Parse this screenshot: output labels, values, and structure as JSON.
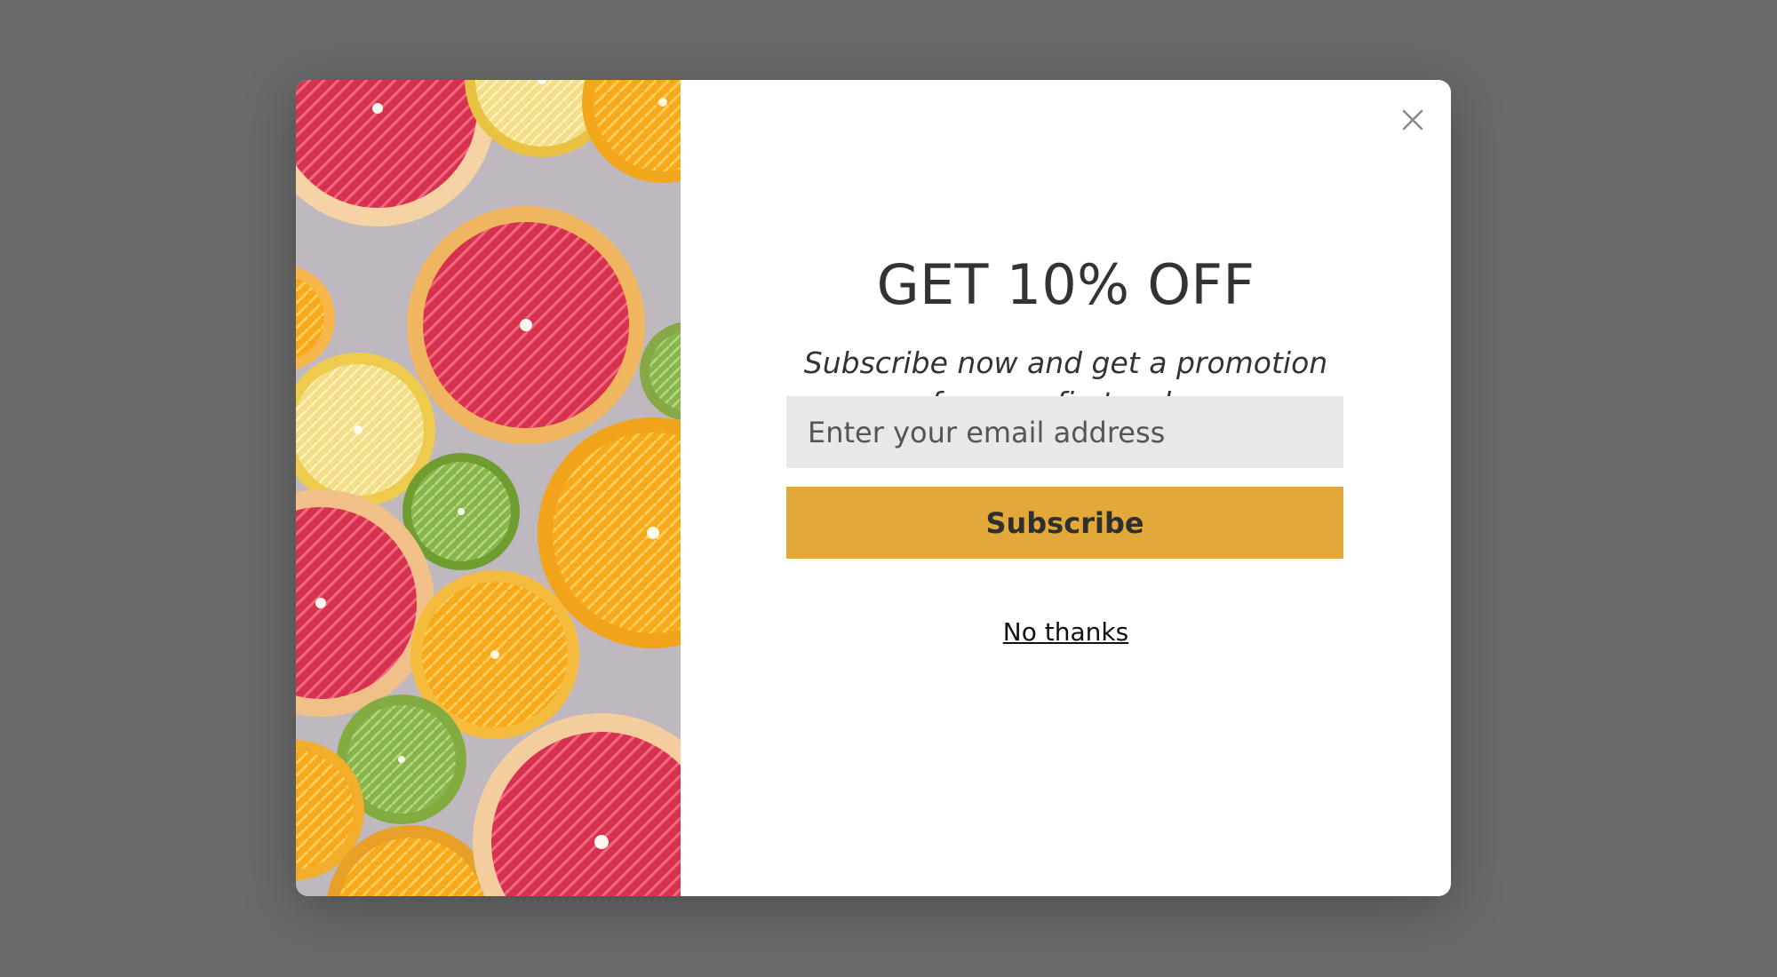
{
  "popup": {
    "title": "GET 10% OFF",
    "subtitle": "Subscribe now and get a promotion for your first order",
    "email_placeholder": "Enter your email address",
    "subscribe_label": "Subscribe",
    "no_thanks_label": "No thanks",
    "close_icon": "close-icon"
  },
  "colors": {
    "overlay": "#6a6a6a",
    "modal_background": "#ffffff",
    "input_background": "#e8e8e8",
    "button_accent": "#e2a93a",
    "text_primary": "#333333"
  },
  "image": {
    "subject": "citrus-fruit-slices"
  }
}
